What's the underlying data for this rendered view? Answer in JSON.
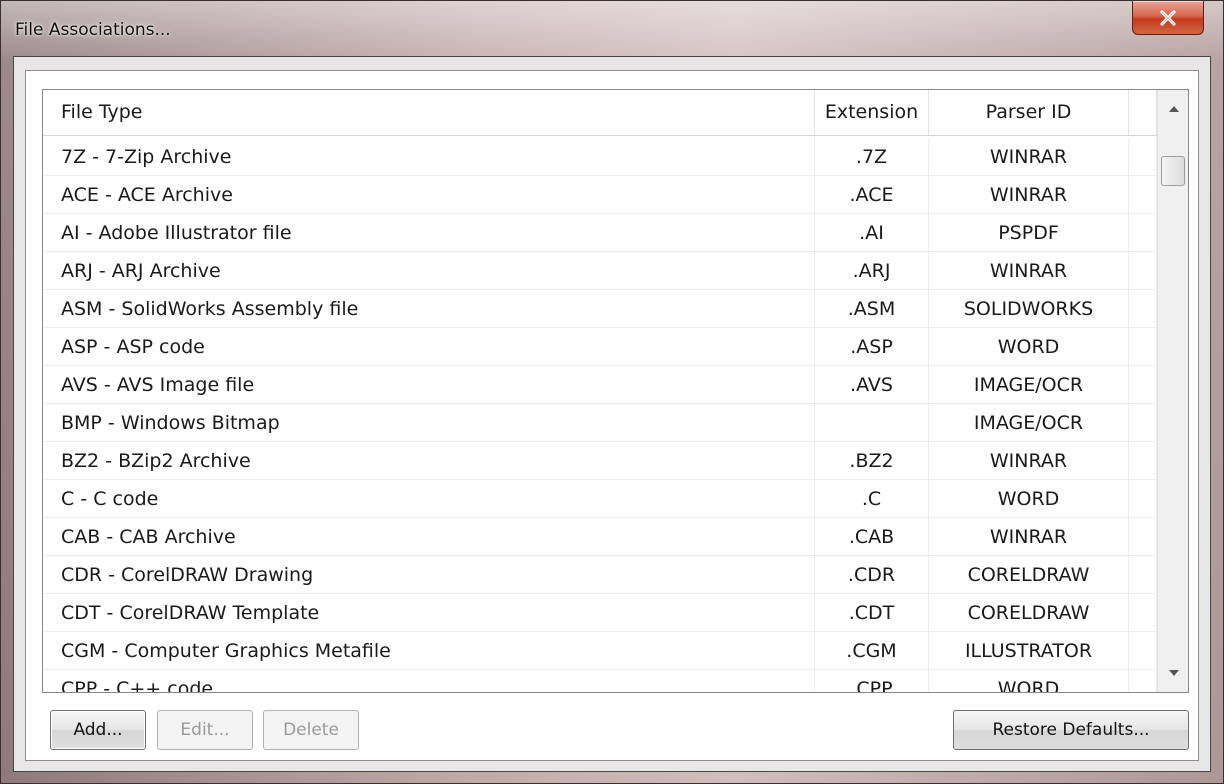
{
  "window": {
    "title": "File Associations..."
  },
  "table": {
    "headers": [
      "File Type",
      "Extension",
      "Parser ID"
    ],
    "rows": [
      {
        "type": "7Z - 7-Zip Archive",
        "ext": ".7Z",
        "parser": "WINRAR"
      },
      {
        "type": "ACE - ACE Archive",
        "ext": ".ACE",
        "parser": "WINRAR"
      },
      {
        "type": "AI - Adobe Illustrator file",
        "ext": ".AI",
        "parser": "PSPDF"
      },
      {
        "type": "ARJ - ARJ Archive",
        "ext": ".ARJ",
        "parser": "WINRAR"
      },
      {
        "type": "ASM - SolidWorks Assembly file",
        "ext": ".ASM",
        "parser": "SOLIDWORKS"
      },
      {
        "type": "ASP - ASP code",
        "ext": ".ASP",
        "parser": "WORD"
      },
      {
        "type": "AVS - AVS Image file",
        "ext": ".AVS",
        "parser": "IMAGE/OCR"
      },
      {
        "type": "BMP - Windows Bitmap",
        "ext": "",
        "parser": "IMAGE/OCR"
      },
      {
        "type": "BZ2 - BZip2 Archive",
        "ext": ".BZ2",
        "parser": "WINRAR"
      },
      {
        "type": "C - C code",
        "ext": ".C",
        "parser": "WORD"
      },
      {
        "type": "CAB - CAB Archive",
        "ext": ".CAB",
        "parser": "WINRAR"
      },
      {
        "type": "CDR - CorelDRAW Drawing",
        "ext": ".CDR",
        "parser": "CORELDRAW"
      },
      {
        "type": "CDT - CorelDRAW Template",
        "ext": ".CDT",
        "parser": "CORELDRAW"
      },
      {
        "type": "CGM - Computer Graphics Metafile",
        "ext": ".CGM",
        "parser": "ILLUSTRATOR"
      },
      {
        "type": "CPP - C++ code",
        "ext": ".CPP",
        "parser": "WORD"
      }
    ]
  },
  "buttons": {
    "add": "Add...",
    "edit": "Edit...",
    "delete": "Delete",
    "restore": "Restore Defaults..."
  },
  "icons": {
    "close": "close-icon",
    "scroll_up": "chevron-up-icon",
    "scroll_down": "chevron-down-icon"
  }
}
